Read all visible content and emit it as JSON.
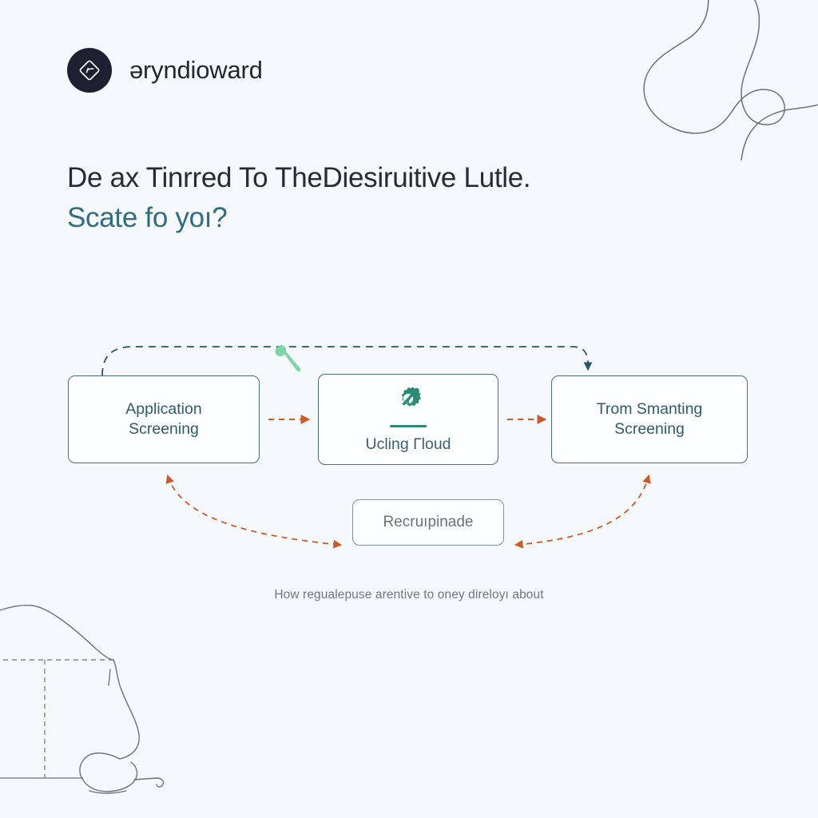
{
  "brand": {
    "name": "əryndioward",
    "mark_icon": "diamond-logo-icon",
    "mark_color": "#1d2030"
  },
  "hero": {
    "headline": "De ax Tinrred To TheDiesiruitive Lutle.",
    "subheadline": "Scate fo yoı?",
    "headline_color": "#272b33",
    "subheadline_color": "#2f6d82"
  },
  "diagram": {
    "nodes": [
      {
        "id": "application-screening",
        "label": "Application\nScreening"
      },
      {
        "id": "ucling-cloud",
        "label": "Ucling Гloud",
        "icon": "gear-wrench-icon"
      },
      {
        "id": "trom-smanting-screening",
        "label": "Trom Smanting\nScreening"
      },
      {
        "id": "recruipinade",
        "label": "Recruıpinade"
      }
    ],
    "accent_icon": "wrench-icon",
    "colors": {
      "node_border": "#4a6e7e",
      "node_border_muted": "#7f93a0",
      "node_text": "#2f5b6b",
      "node_text_muted": "#6c727a",
      "flow_arrow": "#cf5a28",
      "feedback_arrow": "#2f5b6b",
      "icon_teal": "#2d8a77",
      "accent_green": "#7fd6a4"
    }
  },
  "caption": {
    "text": "How regualepuse arentive to oney direloyı about"
  },
  "decor": {
    "topright": "squiggle-line-art",
    "bottomleft": "sketch-line-art",
    "stroke": "#6d7278"
  },
  "background": "#f6f9fc"
}
